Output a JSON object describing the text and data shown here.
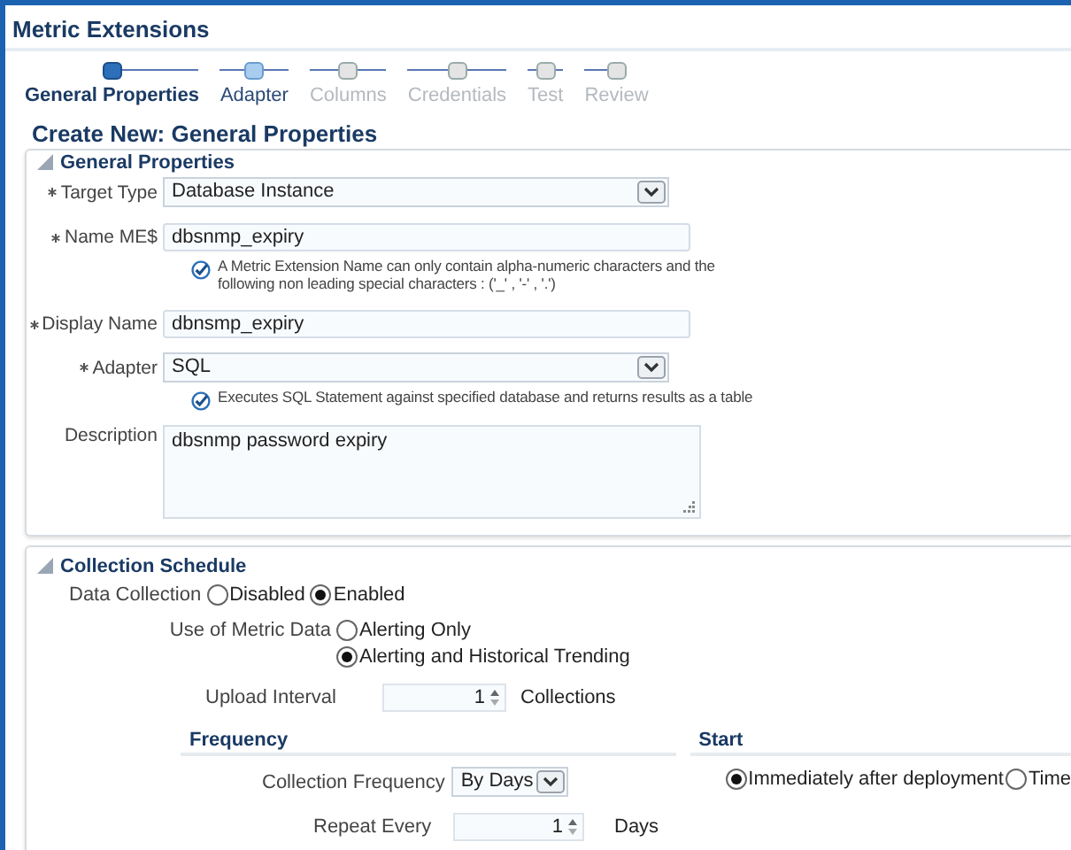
{
  "header": {
    "title": "Metric Extensions"
  },
  "train": [
    {
      "label": "General Properties",
      "selected": true,
      "disabled": false
    },
    {
      "label": "Adapter",
      "selected": false,
      "disabled": false
    },
    {
      "label": "Columns",
      "selected": false,
      "disabled": true
    },
    {
      "label": "Credentials",
      "selected": false,
      "disabled": true
    },
    {
      "label": "Test",
      "selected": false,
      "disabled": true
    },
    {
      "label": "Review",
      "selected": false,
      "disabled": true
    }
  ],
  "page_title": "Create New: General Properties",
  "general": {
    "title": "General Properties",
    "expanded": true,
    "fields": [
      {
        "kind": "select",
        "label": "Target Type",
        "required": true,
        "value": "Database Instance"
      },
      {
        "kind": "text",
        "label": "Name ME$",
        "required": true,
        "value": "dbsnmp_expiry",
        "hint": "A Metric Extension Name can only contain alpha-numeric characters and the following non leading special characters : ('_' , '-' , '.')"
      },
      {
        "kind": "text",
        "label": "Display Name",
        "required": true,
        "value": "dbnsmp_expiry"
      },
      {
        "kind": "select",
        "label": "Adapter",
        "required": true,
        "value": "SQL",
        "hint": "Executes SQL Statement against specified database and returns results as a table"
      },
      {
        "kind": "textarea",
        "label": "Description",
        "required": false,
        "value": "dbsnmp password expiry"
      }
    ]
  },
  "schedule": {
    "title": "Collection Schedule",
    "expanded": true,
    "data_collection": {
      "label": "Data Collection",
      "options": [
        {
          "label": "Disabled",
          "selected": false
        },
        {
          "label": "Enabled",
          "selected": true
        }
      ]
    },
    "use_of_metric_data": {
      "label": "Use of Metric Data",
      "options": [
        {
          "label": "Alerting Only",
          "selected": false
        },
        {
          "label": "Alerting and Historical Trending",
          "selected": true
        }
      ]
    },
    "upload_interval": {
      "label": "Upload Interval",
      "value": "1",
      "unit": "Collections"
    },
    "frequency": {
      "title": "Frequency",
      "collection_frequency": {
        "label": "Collection Frequency",
        "value": "By Days"
      },
      "repeat_every": {
        "label": "Repeat Every",
        "value": "1",
        "unit": "Days"
      }
    },
    "start": {
      "title": "Start",
      "options": [
        {
          "label": "Immediately after deployment",
          "selected": true
        },
        {
          "label": "Time",
          "selected": false
        }
      ]
    }
  }
}
